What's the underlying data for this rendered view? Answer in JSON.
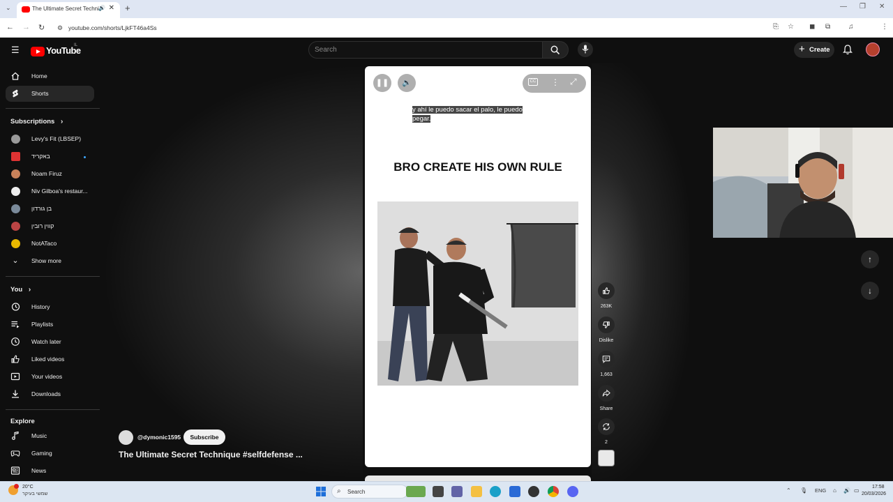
{
  "browser": {
    "tab_title": "The Ultimate Secret Techni",
    "url": "youtube.com/shorts/LjkFT46a4Ss"
  },
  "youtube": {
    "logo_text": "YouTube",
    "logo_country": "IL",
    "search_placeholder": "Search",
    "create_label": "Create"
  },
  "sidebar": {
    "main": [
      {
        "label": "Home",
        "icon": "home-icon"
      },
      {
        "label": "Shorts",
        "icon": "shorts-icon",
        "active": true
      }
    ],
    "subscriptions_title": "Subscriptions",
    "subscriptions": [
      {
        "label": "Levy's Fit (LBSEP)",
        "color": "#9a9a9a"
      },
      {
        "label": "באקריד",
        "color": "#d33"
      },
      {
        "label": "Noam Firuz",
        "color": "#c9825a"
      },
      {
        "label": "Niv Gilboa's restaur...",
        "color": "#eee"
      },
      {
        "label": "בן גורדון",
        "color": "#7a8a9a"
      },
      {
        "label": "קווין רובין",
        "color": "#b44"
      },
      {
        "label": "NotATaco",
        "color": "#e8b800"
      }
    ],
    "show_more": "Show more",
    "you_title": "You",
    "you_items": [
      {
        "label": "History",
        "icon": "history-icon"
      },
      {
        "label": "Playlists",
        "icon": "playlists-icon"
      },
      {
        "label": "Watch later",
        "icon": "watch-later-icon"
      },
      {
        "label": "Liked videos",
        "icon": "liked-videos-icon"
      },
      {
        "label": "Your videos",
        "icon": "your-videos-icon"
      },
      {
        "label": "Downloads",
        "icon": "downloads-icon"
      }
    ],
    "explore_title": "Explore",
    "explore_items": [
      {
        "label": "Music",
        "icon": "music-icon"
      },
      {
        "label": "Gaming",
        "icon": "gaming-icon"
      },
      {
        "label": "News",
        "icon": "news-icon"
      }
    ]
  },
  "short": {
    "caption_line1": "y ahí le puedo sacar el palo, le puedo",
    "caption_line2": "pegar.",
    "overlay_title": "BRO CREATE HIS OWN RULE",
    "channel": "@dymonic1595",
    "subscribe_label": "Subscribe",
    "title": "The Ultimate Secret Technique #selfdefense ..."
  },
  "actions": {
    "likes": "263K",
    "dislike": "Dislike",
    "comments": "1,663",
    "share": "Share",
    "remix": "2"
  },
  "taskbar": {
    "weather_temp": "20°C",
    "weather_desc": "שמשי בעיקר",
    "search_label": "Search",
    "language": "ENG",
    "time": "17:58",
    "date": "20/03/2026"
  }
}
